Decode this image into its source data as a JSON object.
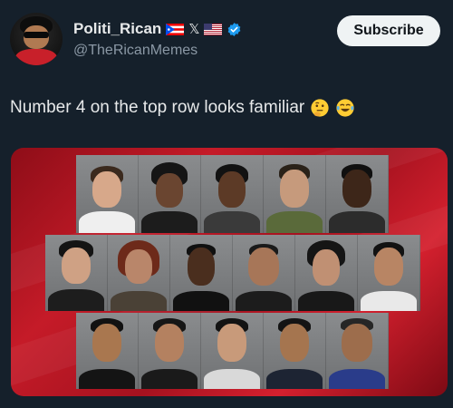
{
  "account": {
    "display_name": "Politi_Rican",
    "handle": "@TheRicanMemes",
    "x_glyph": "𝕏",
    "verified": true,
    "badges": [
      "puerto-rico-flag-icon",
      "x-logo-icon",
      "us-flag-icon",
      "verified-badge-icon"
    ]
  },
  "actions": {
    "subscribe_label": "Subscribe"
  },
  "tweet": {
    "text": "Number 4 on the top row looks familiar",
    "emojis": [
      "thinking-face-emoji",
      "tears-of-joy-emoji"
    ]
  },
  "colors": {
    "background": "#15202b",
    "text_primary": "#e7e9ea",
    "text_secondary": "#8b98a5",
    "verified_blue": "#1d9bf0",
    "media_red": "#c51b28"
  }
}
